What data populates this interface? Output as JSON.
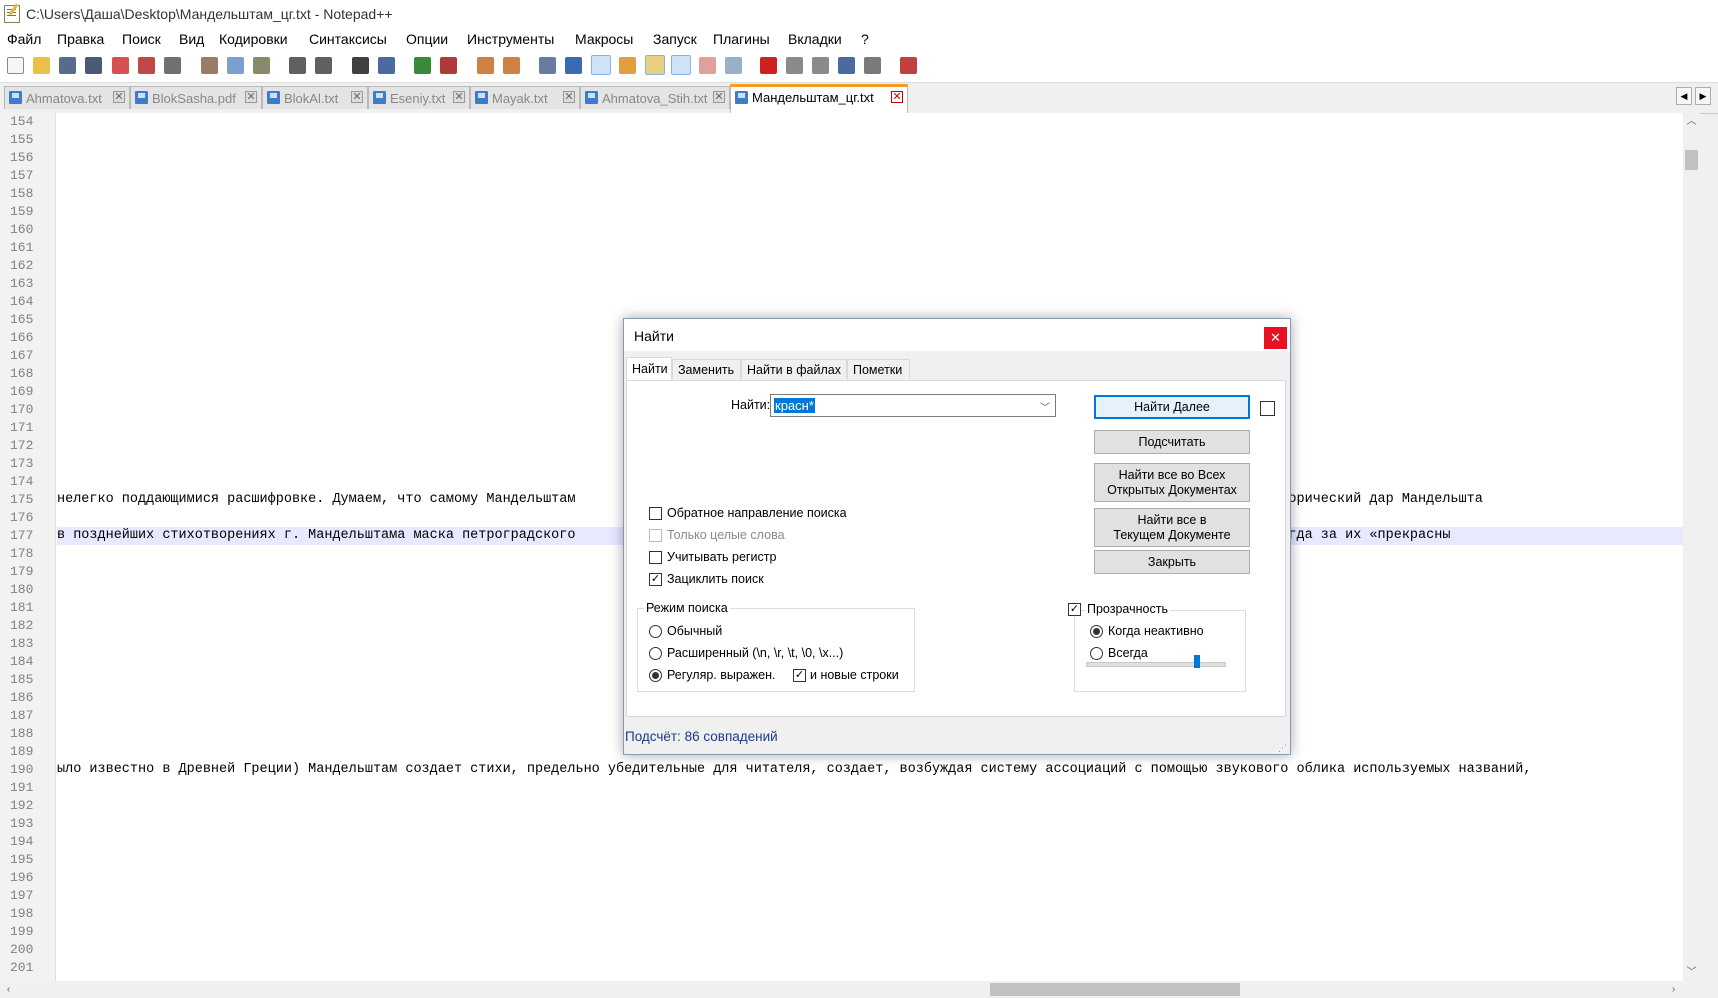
{
  "window": {
    "title": "C:\\Users\\Даша\\Desktop\\Мандельштам_цг.txt - Notepad++"
  },
  "menu": [
    "Файл",
    "Правка",
    "Поиск",
    "Вид",
    "Кодировки",
    "Синтаксисы",
    "Опции",
    "Инструменты",
    "Макросы",
    "Запуск",
    "Плагины",
    "Вкладки",
    "?"
  ],
  "tabs": [
    {
      "label": "Ahmatova.txt",
      "active": false
    },
    {
      "label": "BlokSasha.pdf",
      "active": false
    },
    {
      "label": "BlokAl.txt",
      "active": false
    },
    {
      "label": "Eseniy.txt",
      "active": false
    },
    {
      "label": "Mayak.txt",
      "active": false
    },
    {
      "label": "Ahmatova_Stih.txt",
      "active": false
    },
    {
      "label": "Мандельштам_цг.txt",
      "active": true
    }
  ],
  "editor": {
    "first_line": 154,
    "last_line": 201,
    "lines": {
      "175": "нелегко поддающимися расшифровке. Думаем, что самому Мандельштам                                                                  рецензент хвалит метафорический дар Мандельшта",
      "177": "в позднейших стихотворениях г. Мандельштама маска петроградского                                                                 досадно комическими, когда за их «прекрасны",
      "190": "ыло известно в Древней Греции) Мандельштам создает стихи, предельно убедительные для читателя, создает, возбуждая систему ассоциаций с помощью звукового облика используемых названий,"
    },
    "current_line": 177
  },
  "find_dialog": {
    "title": "Найти",
    "close_glyph": "✕",
    "tabs": [
      "Найти",
      "Заменить",
      "Найти в файлах",
      "Пометки"
    ],
    "find_label": "Найти:",
    "find_value": "красн*",
    "buttons": {
      "find_next": "Найти Далее",
      "count": "Подсчитать",
      "find_all_open_l1": "Найти все во Всех",
      "find_all_open_l2": "Открытых Документах",
      "find_all_current_l1": "Найти все в",
      "find_all_current_l2": "Текущем Документе",
      "close": "Закрыть"
    },
    "options": {
      "backward": {
        "label": "Обратное направление поиска",
        "checked": false
      },
      "whole_word": {
        "label": "Только целые слова",
        "checked": false,
        "disabled": true
      },
      "match_case": {
        "label": "Учитывать регистр",
        "checked": false
      },
      "wrap": {
        "label": "Зациклить поиск",
        "checked": true
      }
    },
    "search_mode": {
      "title": "Режим поиска",
      "normal": "Обычный",
      "extended": "Расширенный (\\n, \\r, \\t, \\0, \\x...)",
      "regex": "Регуляр. выражен.",
      "newline": "и новые строки",
      "selected": "regex",
      "newline_checked": true
    },
    "transparency": {
      "label": "Прозрачность",
      "checked": true,
      "on_inactive": "Когда неактивно",
      "always": "Всегда",
      "selected": "on_inactive",
      "level": 0.65
    },
    "status": "Подсчёт: 86 совпадений"
  }
}
